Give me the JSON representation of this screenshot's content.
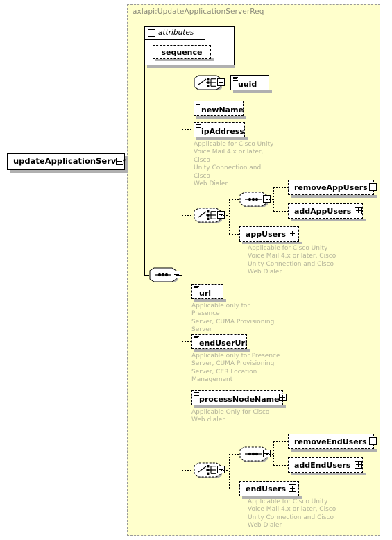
{
  "diagram": {
    "type": "xml-schema-tree",
    "root_element": {
      "name": "updateApplicationServer",
      "toggle": "minus"
    },
    "container": {
      "title": "axlapi:UpdateApplicationServerReq"
    },
    "attributes_group": {
      "label": "attributes",
      "toggle": "minus",
      "child": "sequence"
    },
    "compositors": {
      "choice_uuid": "choice",
      "main_sequence": "sequence",
      "choice_appusers": "choice",
      "sequence_appusers": "sequence",
      "choice_endusers": "choice",
      "sequence_endusers": "sequence"
    },
    "elements": [
      {
        "name": "uuid",
        "optional": false,
        "toggle": null,
        "typeicon": true
      },
      {
        "name": "newName",
        "optional": true,
        "toggle": null,
        "typeicon": true
      },
      {
        "name": "ipAddress",
        "optional": true,
        "toggle": null,
        "typeicon": true
      },
      {
        "name": "removeAppUsers",
        "optional": true,
        "toggle": "plus",
        "typeicon": false
      },
      {
        "name": "addAppUsers",
        "optional": true,
        "toggle": "plus",
        "typeicon": false
      },
      {
        "name": "appUsers",
        "optional": true,
        "toggle": "plus",
        "typeicon": false
      },
      {
        "name": "url",
        "optional": true,
        "toggle": null,
        "typeicon": true
      },
      {
        "name": "endUserUrl",
        "optional": true,
        "toggle": null,
        "typeicon": true
      },
      {
        "name": "processNodeName",
        "optional": true,
        "toggle": "plus",
        "typeicon": true
      },
      {
        "name": "removeEndUsers",
        "optional": true,
        "toggle": "plus",
        "typeicon": false
      },
      {
        "name": "addEndUsers",
        "optional": true,
        "toggle": "plus",
        "typeicon": false
      },
      {
        "name": "endUsers",
        "optional": true,
        "toggle": "plus",
        "typeicon": false
      }
    ],
    "annotations": [
      {
        "for": "ipAddress",
        "text": "Applicable for Cisco Unity\nVoice Mail 4.x or later, Cisco\nUnity Connection and Cisco\nWeb Dialer"
      },
      {
        "for": "appUsers",
        "text": "Applicable for Cisco Unity\nVoice Mail 4.x or later, Cisco\nUnity Connection and Cisco\nWeb Dialer"
      },
      {
        "for": "url",
        "text": "Applicable only for Presence\nServer, CUMA Provisioning\nServer"
      },
      {
        "for": "endUserUrl",
        "text": "Applicable only for Presence\nServer, CUMA Provisioning\nServer, CER Location\nManagement"
      },
      {
        "for": "processNodeName",
        "text": "Applicable Only for Cisco\nWeb dialer"
      },
      {
        "for": "endUsers",
        "text": "Applicable for Cisco Unity\nVoice Mail 4.x or later, Cisco\nUnity Connection and Cisco\nWeb Dialer"
      }
    ],
    "colors": {
      "container_background": "#ffffcc",
      "container_border": "#999999",
      "node_background": "#ffffff",
      "node_border": "#000000",
      "annotation_text": "#b3b39a",
      "title_text": "#8a8a7a",
      "shadow": "#b0b0b0"
    }
  }
}
